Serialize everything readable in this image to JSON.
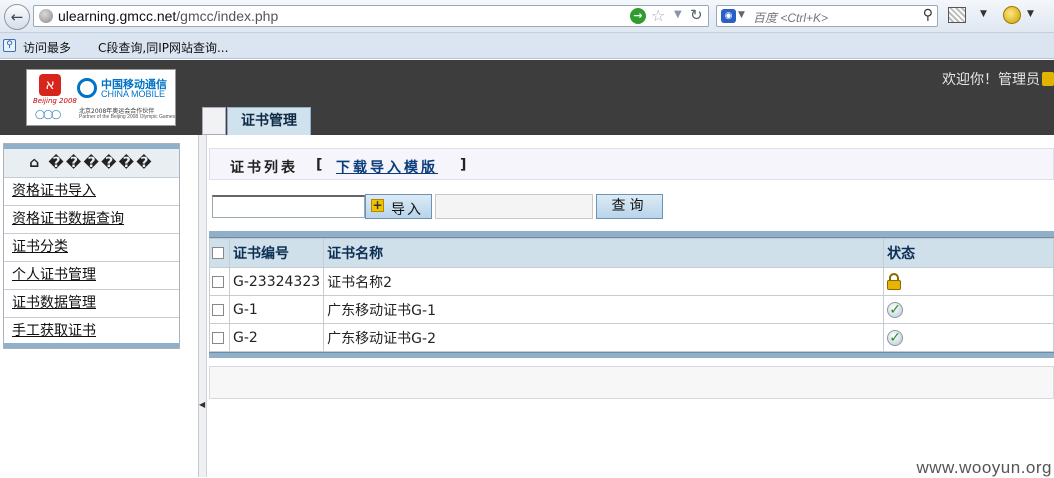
{
  "browser": {
    "url_host": "ulearning.gmcc.net",
    "url_path": "/gmcc/index.php",
    "search_placeholder": "百度 <Ctrl+K>",
    "bookmarks": [
      "访问最多",
      "C段查询,同IP网站查询..."
    ]
  },
  "header": {
    "logo": {
      "beijing_mark": "Beijing 2008",
      "cm_name_cn": "中国移动通信",
      "cm_name_en": "CHINA MOBILE",
      "partner_cn": "北京2008年奥运会合作伙伴",
      "partner_en": "Partner of the Beijing 2008 Olympic Games"
    },
    "welcome": "欢迎你！管理员",
    "active_tab": "证书管理"
  },
  "sidebar": {
    "heading": "������",
    "items": [
      "资格证书导入",
      "资格证书数据查询",
      "证书分类",
      "个人证书管理",
      "证书数据管理",
      "手工获取证书"
    ]
  },
  "main": {
    "title": "证书列表",
    "bracket_open": "[",
    "download_link": "下载导入模版",
    "bracket_close": "]",
    "import_button": "导入",
    "query_button": "查询",
    "table": {
      "columns": [
        "证书编号",
        "证书名称",
        "状态"
      ],
      "rows": [
        {
          "id": "G-23324323",
          "name": "证书名称2",
          "status": "locked"
        },
        {
          "id": "G-1",
          "name": "广东移动证书G-1",
          "status": "checked"
        },
        {
          "id": "G-2",
          "name": "广东移动证书G-2",
          "status": "checked"
        }
      ]
    }
  },
  "watermark": "www.wooyun.org",
  "colors": {
    "header_bg": "#3d3d3d",
    "accent_blue": "#8fb0c8",
    "table_header_bg": "#cfe0ea"
  }
}
